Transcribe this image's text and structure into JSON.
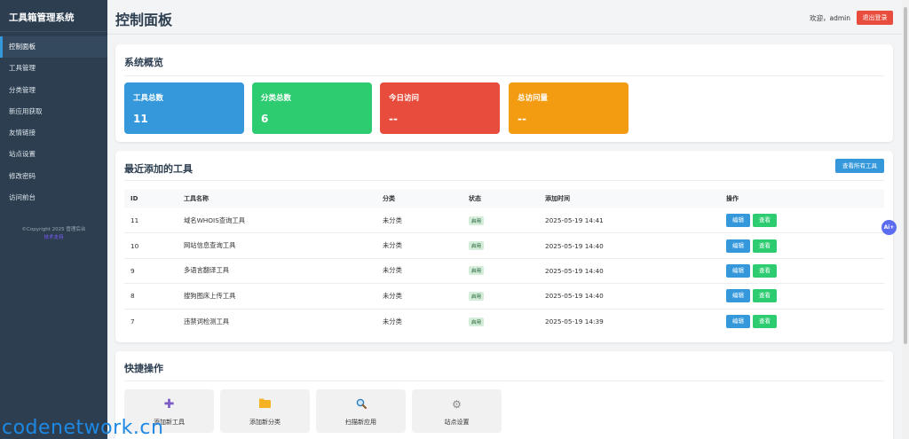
{
  "app": {
    "title": "工具箱管理系统"
  },
  "sidebar": {
    "items": [
      {
        "label": "控制面板"
      },
      {
        "label": "工具管理"
      },
      {
        "label": "分类管理"
      },
      {
        "label": "新应用获取"
      },
      {
        "label": "友情链接"
      },
      {
        "label": "站点设置"
      },
      {
        "label": "修改密码"
      },
      {
        "label": "访问前台"
      }
    ],
    "copyright": "©Copyright 2025 管理后台",
    "copyright_link": "技术支持"
  },
  "header": {
    "title": "控制面板",
    "welcome": "欢迎，admin",
    "logout_label": "退出登录"
  },
  "overview": {
    "title": "系统概览",
    "stats": [
      {
        "label": "工具总数",
        "value": "11",
        "color": "#3498db"
      },
      {
        "label": "分类总数",
        "value": "6",
        "color": "#2ecc71"
      },
      {
        "label": "今日访问",
        "value": "--",
        "color": "#e74c3c"
      },
      {
        "label": "总访问量",
        "value": "--",
        "color": "#f39c12"
      }
    ]
  },
  "recent": {
    "title": "最近添加的工具",
    "view_all_label": "查看所有工具",
    "columns": [
      "ID",
      "工具名称",
      "分类",
      "状态",
      "添加时间",
      "操作"
    ],
    "rows": [
      {
        "id": "11",
        "name": "域名WHOIS查询工具",
        "category": "未分类",
        "status": "启用",
        "time": "2025-05-19 14:41"
      },
      {
        "id": "10",
        "name": "网站信息查询工具",
        "category": "未分类",
        "status": "启用",
        "time": "2025-05-19 14:40"
      },
      {
        "id": "9",
        "name": "多语言翻译工具",
        "category": "未分类",
        "status": "启用",
        "time": "2025-05-19 14:40"
      },
      {
        "id": "8",
        "name": "搜狗图床上传工具",
        "category": "未分类",
        "status": "启用",
        "time": "2025-05-19 14:40"
      },
      {
        "id": "7",
        "name": "违禁词检测工具",
        "category": "未分类",
        "status": "启用",
        "time": "2025-05-19 14:39"
      }
    ],
    "edit_label": "编辑",
    "view_label": "查看"
  },
  "quick": {
    "title": "快捷操作",
    "actions": [
      {
        "label": "添加新工具",
        "icon": "plus-icon",
        "glyph": "✚",
        "color": "#7b5cc4"
      },
      {
        "label": "添加新分类",
        "icon": "folder-icon",
        "glyph": "📁",
        "color": "#f5b324"
      },
      {
        "label": "扫描新应用",
        "icon": "magnifier-icon",
        "glyph": "🔍",
        "color": "#3498db"
      },
      {
        "label": "站点设置",
        "icon": "gear-icon",
        "glyph": "⚙",
        "color": "#888888"
      }
    ]
  },
  "ai_badge": "Ai+",
  "watermark": "codenetwork.cn"
}
